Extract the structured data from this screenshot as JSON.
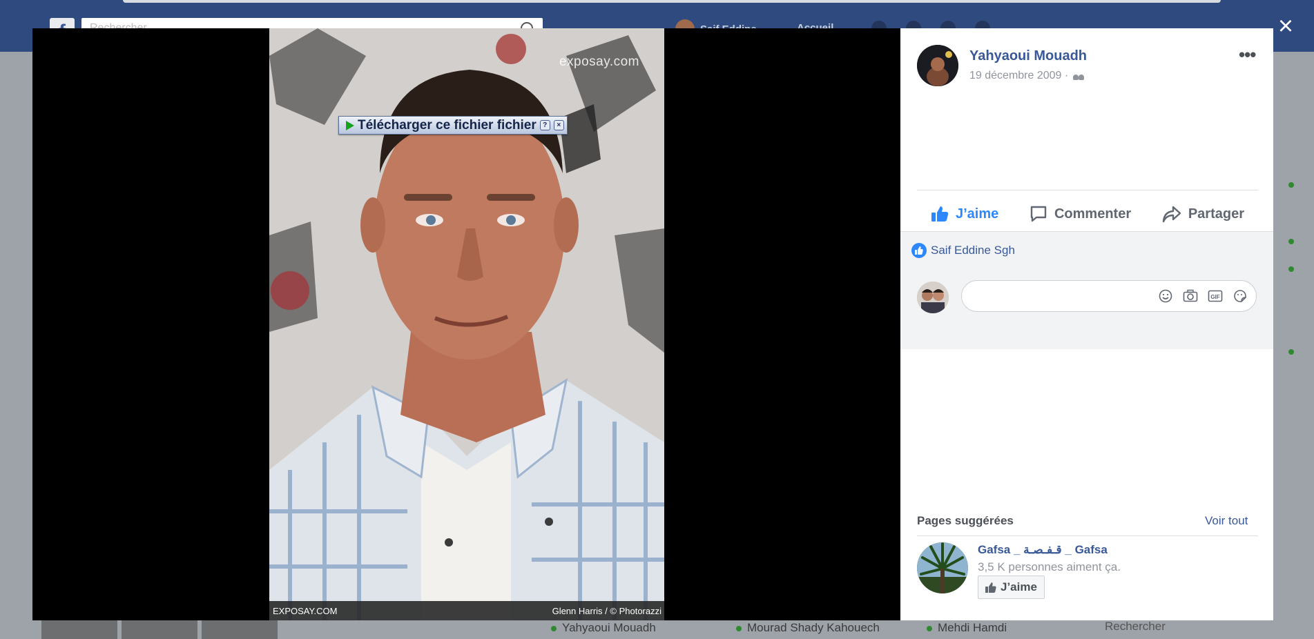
{
  "background": {
    "search_placeholder": "Rechercher",
    "profile_name": "Saif Eddine",
    "home_label": "Accueil",
    "chat_names": [
      "Yahyaoui Mouadh",
      "Mourad Shady Kahouech",
      "Mehdi Hamdi"
    ],
    "chat_search": "Rechercher"
  },
  "lightbox": {
    "close_icon": "close-icon",
    "photo": {
      "watermark": "exposay.com",
      "footer_left": "EXPOSAY.COM",
      "footer_right": "Glenn Harris / © Photorazzi",
      "download_overlay": {
        "label": "Télécharger ce fichier fichier",
        "help": "?",
        "close": "×"
      }
    }
  },
  "post": {
    "author": "Yahyaoui Mouadh",
    "date": "19 décembre 2009 ·",
    "audience_icon": "friends-icon",
    "more_icon": "more-options-icon",
    "actions": {
      "like": "J’aime",
      "comment": "Commenter",
      "share": "Partager"
    },
    "likers": "Saif Eddine Sgh",
    "comment_placeholder": "",
    "comment_icons": [
      "emoji-icon",
      "camera-icon",
      "gif-icon",
      "sticker-icon"
    ]
  },
  "suggested": {
    "title": "Pages suggérées",
    "see_all": "Voir tout",
    "page": {
      "name": "Gafsa _ قـفـصـة _ Gafsa",
      "likes": "3,5 K personnes aiment ça.",
      "like_button": "J’aime"
    }
  },
  "colors": {
    "facebook_blue": "#385898",
    "like_blue": "#2d88ff",
    "topbar": "#2f4a7e"
  }
}
